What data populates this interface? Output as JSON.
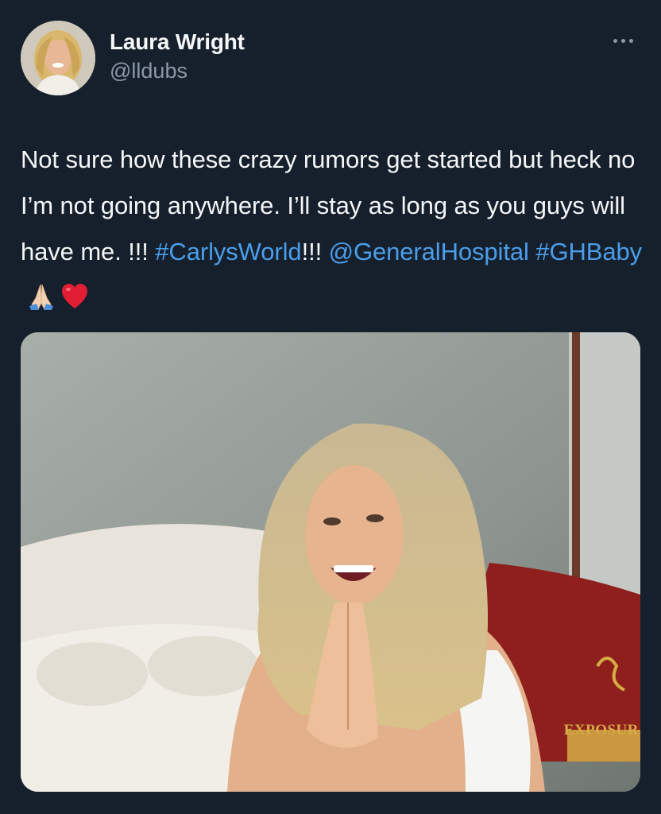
{
  "author": {
    "display_name": "Laura Wright",
    "handle": "@lldubs",
    "avatar_icon": "profile-photo"
  },
  "header": {
    "more_icon": "more-horizontal-icon"
  },
  "tweet": {
    "text_part1": "Not sure how these crazy rumors get started but heck no I’m not going anywhere. I’ll stay as long as you guys will have me. !!! ",
    "hashtag_carlys_world": "#CarlysWorld",
    "text_part2": "!!! ",
    "mention_general_hospital": "@GeneralHospital",
    "space": " ",
    "hashtag_gh_baby": "#GHBaby",
    "emojis": [
      "folded-hands",
      "red-heart"
    ]
  },
  "media": {
    "description_icon": "photo-image",
    "watermark": "EXPOSUR"
  },
  "colors": {
    "background": "#16202c",
    "link": "#4a9eeb",
    "text": "#f4f6f7",
    "secondary": "#8b98a5"
  }
}
